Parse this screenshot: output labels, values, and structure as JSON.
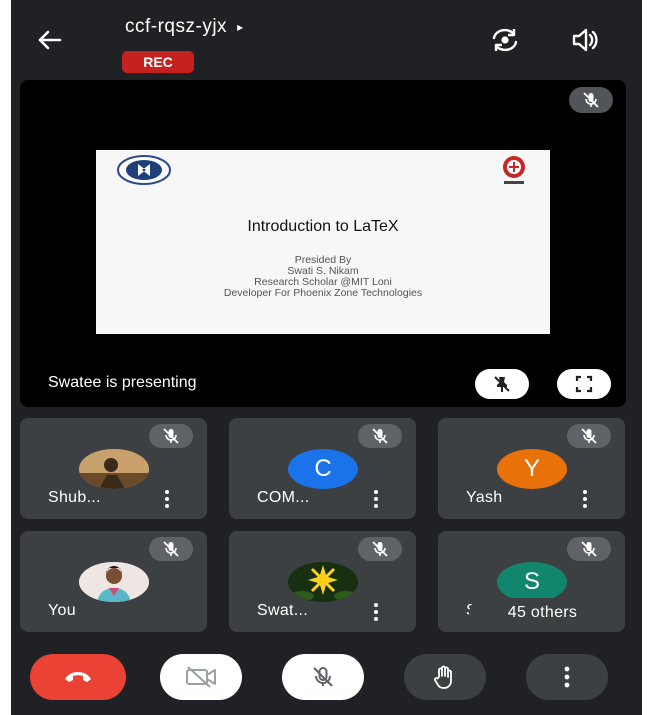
{
  "header": {
    "meeting_code": "ccf-rqsz-yjx",
    "caret": "▸",
    "rec_badge": "REC"
  },
  "stage": {
    "presenting_text": "Swatee is presenting",
    "slide": {
      "title": "Introduction to LaTeX",
      "lines": [
        "Presided By",
        "Swati S. Nikam",
        "Research Scholar @MIT Loni",
        "Developer For Phoenix Zone Technologies"
      ]
    }
  },
  "participants": [
    {
      "name": "Shub...",
      "avatar_type": "photo",
      "avatar_letter": "",
      "avatar_color": "#b08a5a"
    },
    {
      "name": "COM...",
      "avatar_type": "letter",
      "avatar_letter": "C",
      "avatar_color": "#1a73e8"
    },
    {
      "name": "Yash",
      "avatar_type": "letter",
      "avatar_letter": "Y",
      "avatar_color": "#e8710a"
    },
    {
      "name": "You",
      "avatar_type": "photo",
      "avatar_letter": "",
      "avatar_color": "#e8d6cf"
    },
    {
      "name": "Swat...",
      "avatar_type": "photo",
      "avatar_letter": "",
      "avatar_color": "#1f3a14"
    },
    {
      "name": "Sh...",
      "avatar_type": "letter",
      "avatar_letter": "S",
      "avatar_color": "#12866c"
    }
  ],
  "others_label": "45 others",
  "controls": {
    "end_call_color": "#ea4335",
    "icons": [
      "end-call-icon",
      "camera-off-icon",
      "mic-off-icon",
      "raise-hand-icon",
      "more-vert-icon"
    ]
  },
  "colors": {
    "background": "#202124",
    "tile": "#3c4043",
    "rec": "#c5221f"
  }
}
